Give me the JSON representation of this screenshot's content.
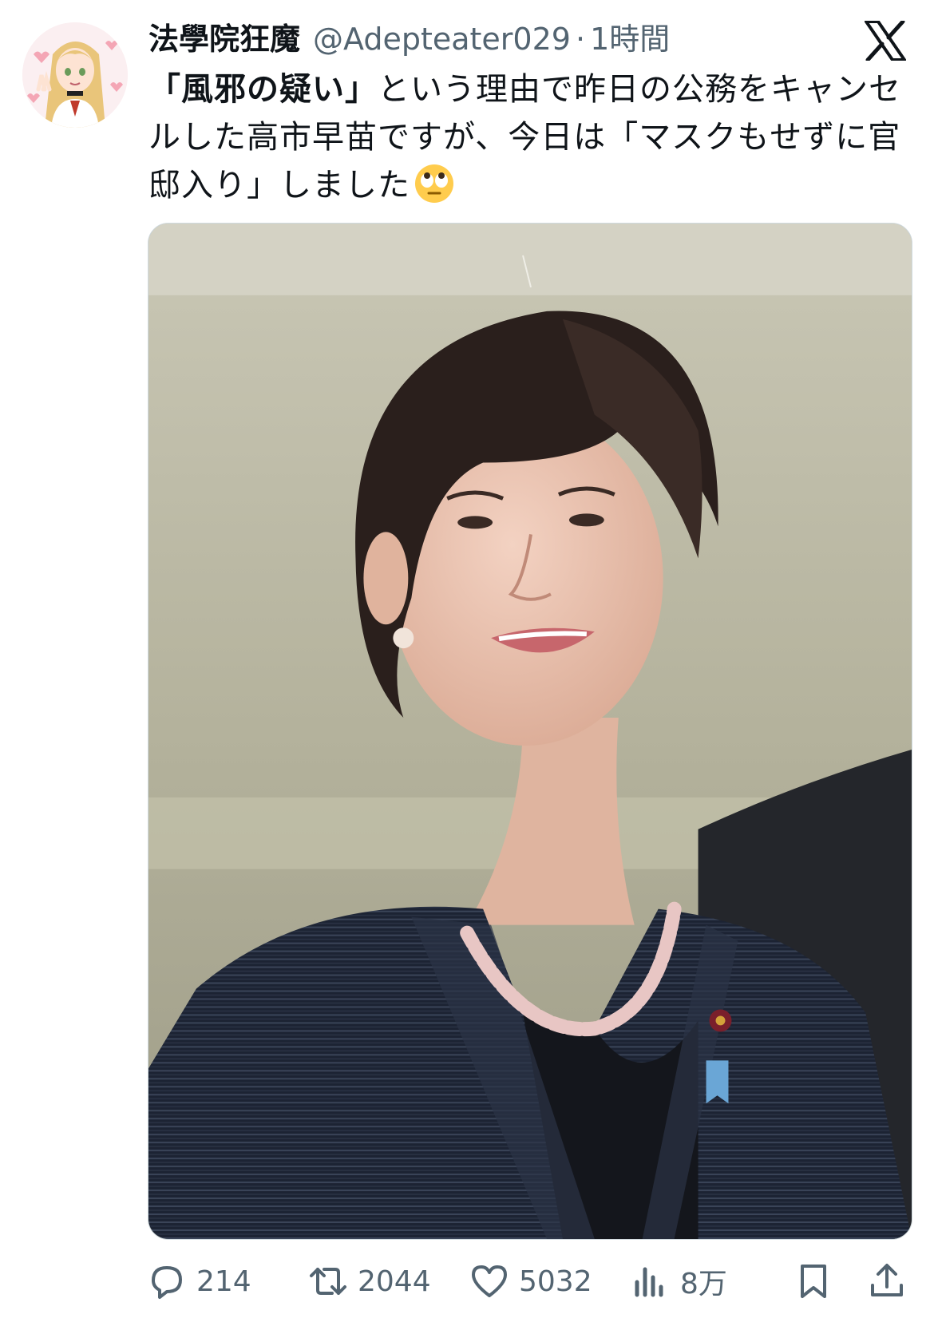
{
  "author": {
    "display_name": "法學院狂魔",
    "handle": "@Adepteater029",
    "separator": "·",
    "time": "1時間"
  },
  "tweet": {
    "text_bold": "「風邪の疑い」",
    "text_rest": "という理由で昨日の公務をキャンセルした高市早苗ですが、今日は「マスクもせずに官邸入り」しました",
    "emoji": "face-with-rolling-eyes"
  },
  "actions": {
    "replies": "214",
    "retweets": "2044",
    "likes": "5032",
    "views": "8万"
  },
  "icons": {
    "reply": "comment-bubble-icon",
    "retweet": "retweet-arrows-icon",
    "like": "heart-icon",
    "views": "bar-chart-icon",
    "bookmark": "bookmark-icon",
    "share": "share-upload-icon",
    "brand": "x-logo-icon"
  },
  "colors": {
    "text": "#0f1419",
    "secondary": "#536471",
    "border": "#cfd9de"
  }
}
